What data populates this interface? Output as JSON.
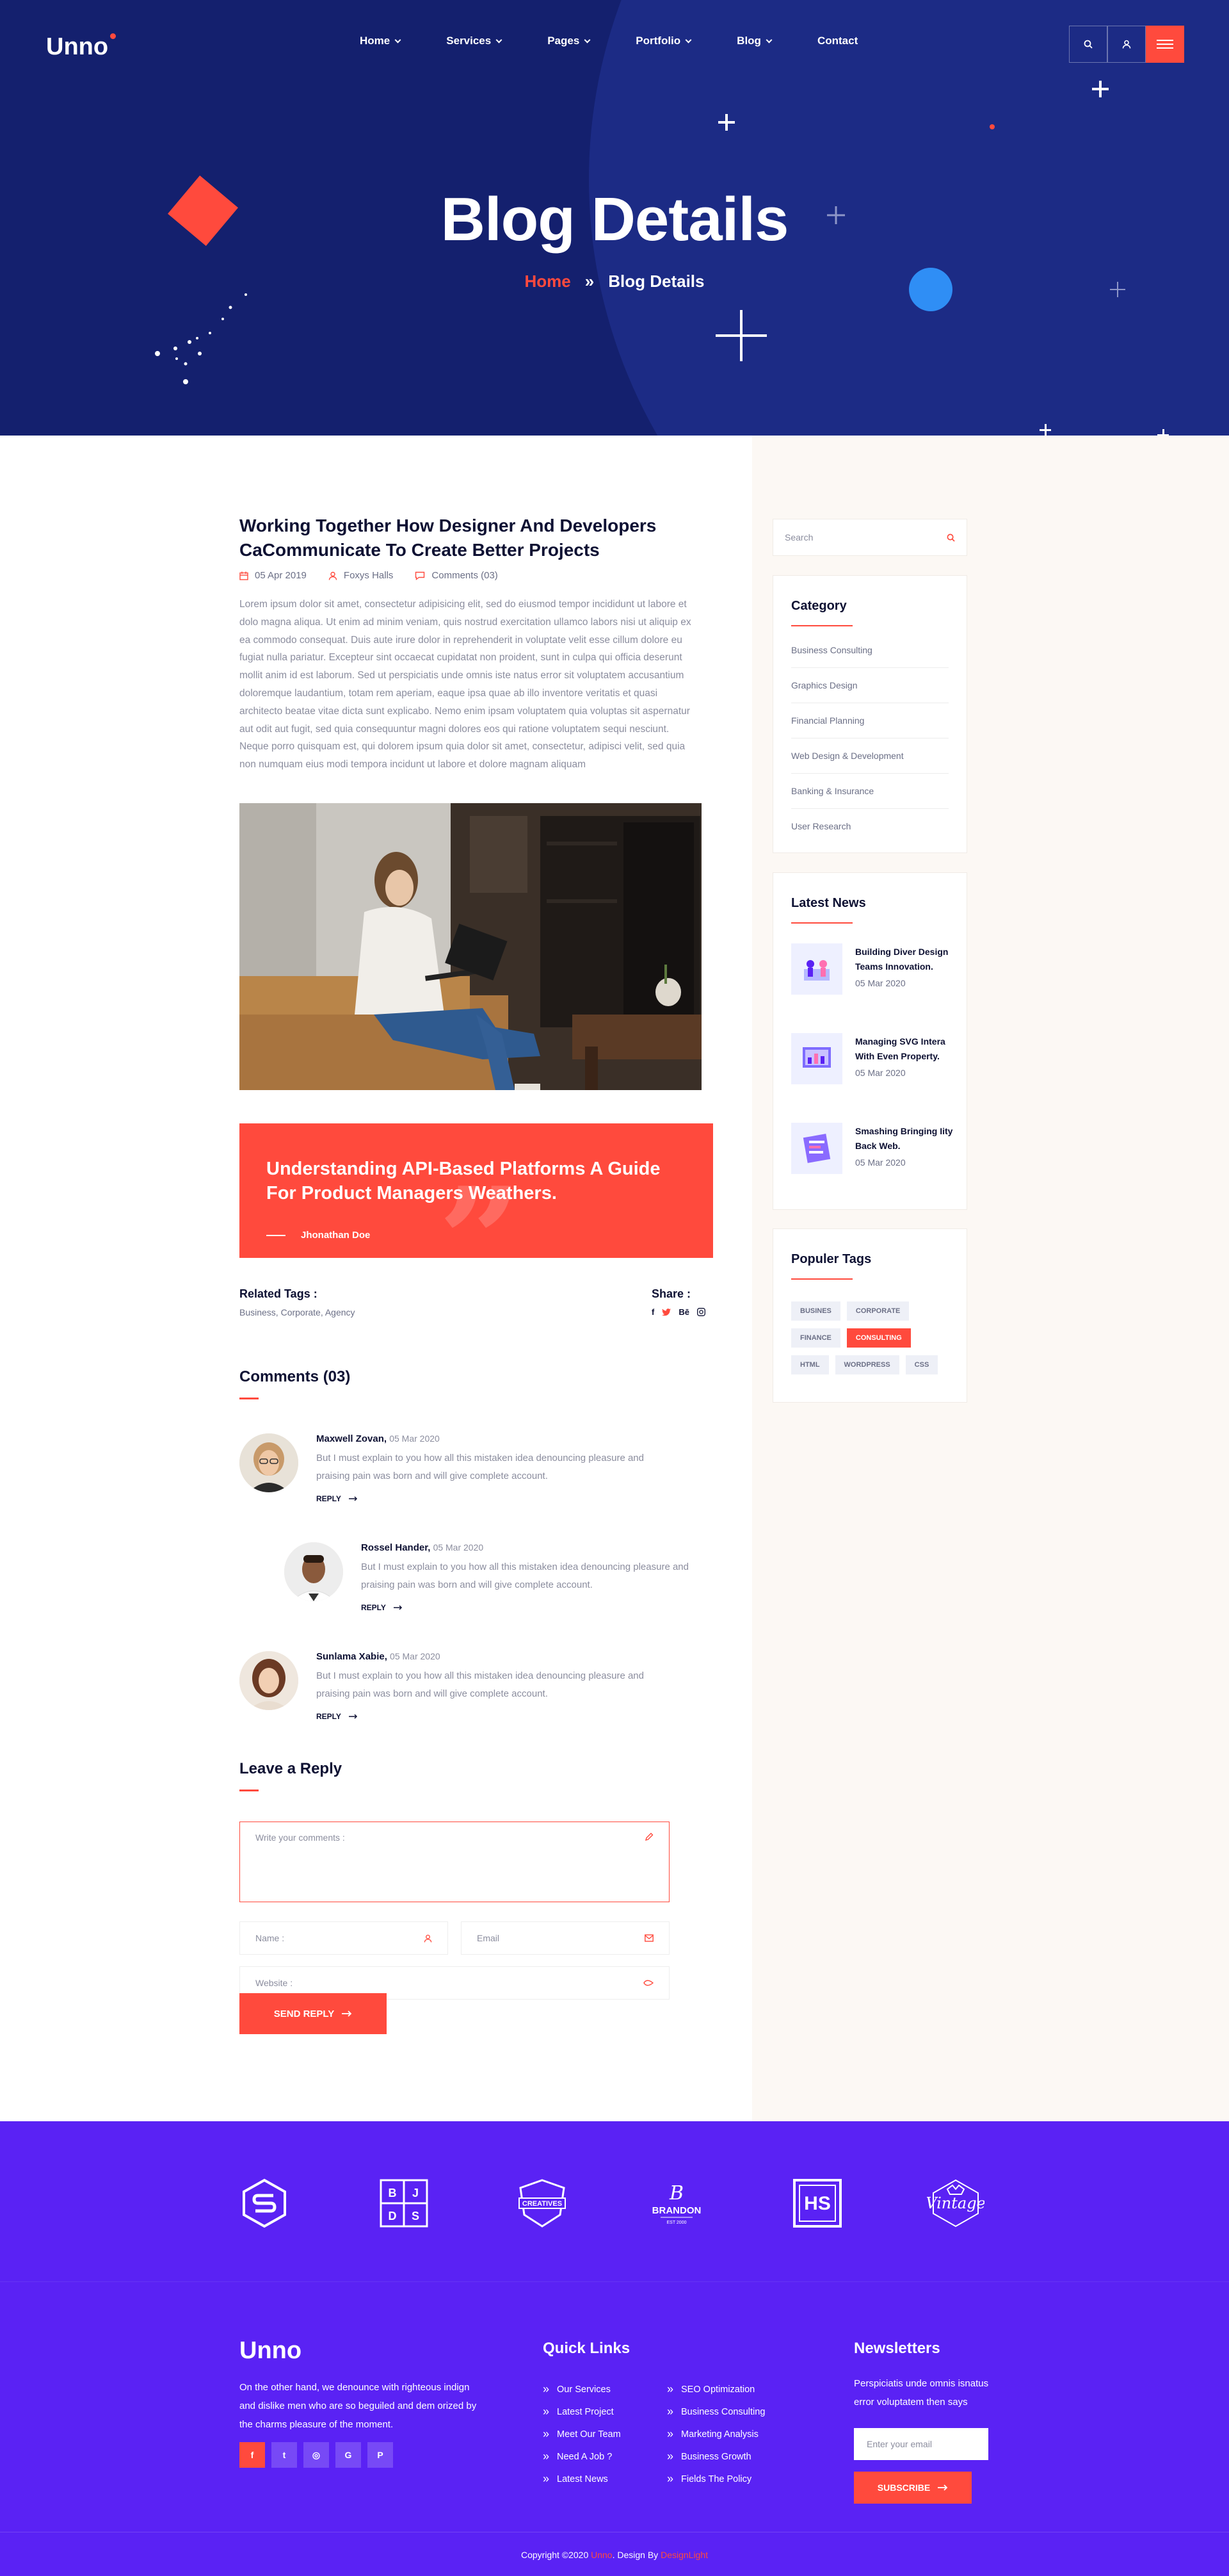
{
  "header": {
    "logo": "Unno",
    "nav": [
      {
        "label": "Home",
        "dropdown": true
      },
      {
        "label": "Services",
        "dropdown": true
      },
      {
        "label": "Pages",
        "dropdown": true
      },
      {
        "label": "Portfolio",
        "dropdown": true
      },
      {
        "label": "Blog",
        "dropdown": true
      },
      {
        "label": "Contact",
        "dropdown": false
      }
    ],
    "tools": [
      "search-icon",
      "user-icon",
      "menu-icon"
    ]
  },
  "hero": {
    "title": "Blog Details",
    "breadcrumb_home": "Home",
    "breadcrumb_sep": "»",
    "breadcrumb_current": "Blog Details"
  },
  "post": {
    "title": "Working Together How Designer And Developers CaCommunicate To Create Better Projects",
    "date": "05 Apr 2019",
    "author": "Foxys Halls",
    "comments": "Comments (03)",
    "body": "Lorem ipsum dolor sit amet, consectetur adipisicing elit, sed do eiusmod tempor incididunt ut labore et dolo magna aliqua. Ut enim ad minim veniam, quis nostrud exercitation ullamco labors nisi ut aliquip ex ea commodo consequat. Duis aute irure dolor in reprehenderit in voluptate velit esse cillum dolore eu fugiat nulla pariatur. Excepteur sint occaecat cupidatat non proident, sunt in culpa qui officia deserunt mollit anim id est laborum. Sed ut perspiciatis unde omnis iste natus error sit voluptatem accusantium doloremque laudantium, totam rem aperiam, eaque ipsa quae ab illo inventore veritatis et quasi architecto beatae vitae dicta sunt explicabo. Nemo enim ipsam voluptatem quia voluptas sit aspernatur aut odit aut fugit, sed quia consequuntur magni dolores eos qui ratione voluptatem sequi nesciunt. Neque porro quisquam est, qui dolorem ipsum quia dolor sit amet, consectetur, adipisci velit, sed quia non numquam eius modi tempora incidunt ut labore et dolore magnam aliquam",
    "quote": "Understanding API-Based Platforms A Guide For Product Managers Weathers.",
    "quote_author": "Jhonathan Doe",
    "related_tags_label": "Related Tags :",
    "related_tags": "Business, Corporate, Agency",
    "share_label": "Share :",
    "share_icons": [
      "facebook-icon",
      "twitter-icon",
      "behance-icon",
      "instagram-icon"
    ],
    "share_behance_text": "Bē"
  },
  "comments": {
    "title": "Comments (03)",
    "reply_label": "REPLY",
    "items": [
      {
        "name": "Maxwell Zovan,",
        "date": "05 Mar 2020",
        "text": "But I must explain to you how all this mistaken idea denouncing pleasure and praising pain was born and will give complete account."
      },
      {
        "name": "Rossel Hander,",
        "date": "05 Mar 2020",
        "text": "But I must explain to you how all this mistaken idea denouncing pleasure and praising pain was born and will give complete account."
      },
      {
        "name": "Sunlama Xabie,",
        "date": "05 Mar 2020",
        "text": "But I must explain to you how all this mistaken idea denouncing pleasure and praising pain was born and will give complete account."
      }
    ]
  },
  "reply_form": {
    "title": "Leave a Reply",
    "comment_placeholder": "Write your comments :",
    "name_placeholder": "Name :",
    "email_placeholder": "Email",
    "website_placeholder": "Website :",
    "submit": "SEND REPLY"
  },
  "sidebar": {
    "search_placeholder": "Search",
    "category_title": "Category",
    "categories": [
      "Business Consulting",
      "Graphics Design",
      "Financial Planning",
      "Web Design & Development",
      "Banking & Insurance",
      "User Research"
    ],
    "news_title": "Latest News",
    "news": [
      {
        "title": "Building Diver Design Teams Innovation.",
        "date": "05 Mar 2020"
      },
      {
        "title": "Managing SVG Intera With Even Property.",
        "date": "05 Mar 2020"
      },
      {
        "title": "Smashing Bringing Iity Back Web.",
        "date": "05 Mar 2020"
      }
    ],
    "tags_title": "Populer Tags",
    "tags": [
      {
        "label": "BUSINES",
        "active": false
      },
      {
        "label": "CORPORATE",
        "active": false
      },
      {
        "label": "FINANCE",
        "active": false
      },
      {
        "label": "CONSULTING",
        "active": true
      },
      {
        "label": "HTML",
        "active": false
      },
      {
        "label": "WORDPRESS",
        "active": false
      },
      {
        "label": "CSS",
        "active": false
      }
    ]
  },
  "brands": {
    "items": [
      "S",
      "B J D S",
      "CREATIVES",
      "BRANDON",
      "HS",
      "Vintage"
    ],
    "brandon_sub": "EST 2000"
  },
  "footer": {
    "logo": "Unno",
    "about": "On the other hand, we denounce with righteous indign and dislike men who are so beguiled and dem orized by the charms pleasure of the moment.",
    "socials": [
      {
        "icon": "facebook-icon",
        "glyph": "f"
      },
      {
        "icon": "twitter-icon",
        "glyph": "t"
      },
      {
        "icon": "instagram-icon",
        "glyph": "◎"
      },
      {
        "icon": "google-icon",
        "glyph": "G"
      },
      {
        "icon": "pinterest-icon",
        "glyph": "P"
      }
    ],
    "quick_links_title": "Quick Links",
    "links_col1": [
      "Our Services",
      "Latest Project",
      "Meet Our Team",
      "Need A Job ?",
      "Latest News"
    ],
    "links_col2": [
      "SEO Optimization",
      "Business Consulting",
      "Marketing Analysis",
      "Business Growth",
      "Fields The Policy"
    ],
    "newsletter_title": "Newsletters",
    "newsletter_text": "Perspiciatis unde omnis isnatus error voluptatem then says",
    "newsletter_placeholder": "Enter your email",
    "subscribe": "SUBSCRIBE",
    "copyright_a": "Copyright ©2020 ",
    "copyright_b": "Unno",
    "copyright_c": ". Design By ",
    "copyright_d": "DesignLight"
  },
  "colors": {
    "accent": "#ff4a3d",
    "hero_bg": "#14206e",
    "footer_bg": "#5a22f4",
    "sidebar_bg": "#fcf8f4"
  }
}
